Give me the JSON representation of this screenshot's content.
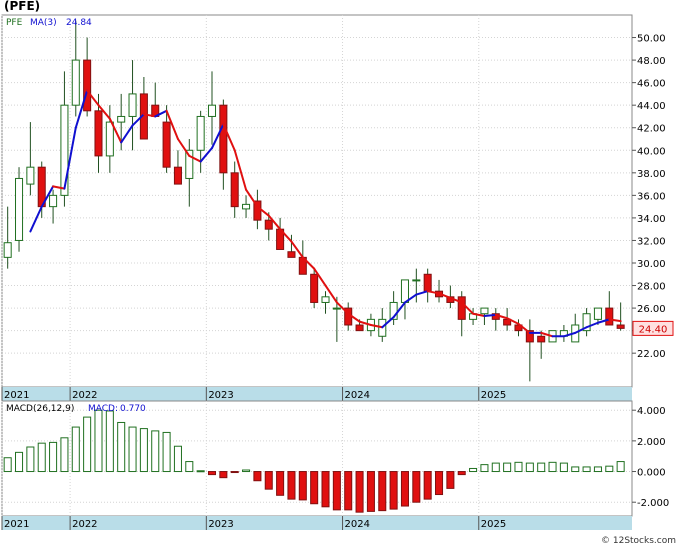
{
  "chart_data": [
    {
      "type": "candlestick",
      "title": "(PFE)",
      "legend": {
        "ticker": "PFE",
        "ma_label": "MA(3)",
        "ma_value": "24.84"
      },
      "last_price_label": "24.40",
      "ylim": [
        19,
        52
      ],
      "y_ticks": [
        22,
        24,
        26,
        28,
        30,
        32,
        34,
        36,
        38,
        40,
        42,
        44,
        46,
        48,
        50
      ],
      "y_tick_labels": [
        "22.00",
        "24.00",
        "26.00",
        "28.00",
        "30.00",
        "32.00",
        "34.00",
        "36.00",
        "38.00",
        "40.00",
        "42.00",
        "44.00",
        "46.00",
        "48.00",
        "50.00"
      ],
      "year_ticks": [
        {
          "label": "2021",
          "index": 0
        },
        {
          "label": "2022",
          "index": 6
        },
        {
          "label": "2023",
          "index": 18
        },
        {
          "label": "2024",
          "index": 30
        },
        {
          "label": "2025",
          "index": 42
        }
      ],
      "candles": [
        [
          30.5,
          35.0,
          29.5,
          31.8
        ],
        [
          32.0,
          38.5,
          31.0,
          37.5
        ],
        [
          37.0,
          42.5,
          36.0,
          38.5
        ],
        [
          38.5,
          39.0,
          34.0,
          35.0
        ],
        [
          35.0,
          36.5,
          33.5,
          36.0
        ],
        [
          36.0,
          47.0,
          35.0,
          44.0
        ],
        [
          44.0,
          51.5,
          43.0,
          48.0
        ],
        [
          48.0,
          50.0,
          43.0,
          43.5
        ],
        [
          43.5,
          45.0,
          38.0,
          39.5
        ],
        [
          39.5,
          44.0,
          38.0,
          42.5
        ],
        [
          42.5,
          45.0,
          40.0,
          43.0
        ],
        [
          43.0,
          48.0,
          40.0,
          45.0
        ],
        [
          45.0,
          46.5,
          41.5,
          41.0
        ],
        [
          44.0,
          46.0,
          43.0,
          43.0
        ],
        [
          42.5,
          44.0,
          38.0,
          38.5
        ],
        [
          38.5,
          40.0,
          37.0,
          37.0
        ],
        [
          37.5,
          41.0,
          35.0,
          40.0
        ],
        [
          40.0,
          43.5,
          38.0,
          43.0
        ],
        [
          43.0,
          47.0,
          40.5,
          44.0
        ],
        [
          44.0,
          44.5,
          36.5,
          38.0
        ],
        [
          38.0,
          39.0,
          34.0,
          35.0
        ],
        [
          34.8,
          36.0,
          34.0,
          35.2
        ],
        [
          35.5,
          36.5,
          33.0,
          33.8
        ],
        [
          33.8,
          34.5,
          32.0,
          33.0
        ],
        [
          33.0,
          34.0,
          31.5,
          31.2
        ],
        [
          31.0,
          32.5,
          31.0,
          30.5
        ],
        [
          30.5,
          32.0,
          29.0,
          29.0
        ],
        [
          29.0,
          29.5,
          26.0,
          26.5
        ],
        [
          26.5,
          27.5,
          25.5,
          27.0
        ],
        [
          26.0,
          27.0,
          23.0,
          26.0
        ],
        [
          26.0,
          26.5,
          24.0,
          24.5
        ],
        [
          24.5,
          25.0,
          24.0,
          24.0
        ],
        [
          24.0,
          25.5,
          23.5,
          25.0
        ],
        [
          23.5,
          26.0,
          23.0,
          25.0
        ],
        [
          25.0,
          27.5,
          24.5,
          26.5
        ],
        [
          26.5,
          28.5,
          25.0,
          28.5
        ],
        [
          28.5,
          29.5,
          26.5,
          28.5
        ],
        [
          29.0,
          29.5,
          26.5,
          27.5
        ],
        [
          27.5,
          28.5,
          26.5,
          27.0
        ],
        [
          27.0,
          28.0,
          26.0,
          26.5
        ],
        [
          27.0,
          27.5,
          23.5,
          25.0
        ],
        [
          25.0,
          26.0,
          24.5,
          25.5
        ],
        [
          25.5,
          26.0,
          24.5,
          26.0
        ],
        [
          25.5,
          26.0,
          24.0,
          25.0
        ],
        [
          25.0,
          26.0,
          24.0,
          24.5
        ],
        [
          24.5,
          25.0,
          23.5,
          24.0
        ],
        [
          24.0,
          25.0,
          19.5,
          23.0
        ],
        [
          23.5,
          24.0,
          21.5,
          23.0
        ],
        [
          23.0,
          24.0,
          23.0,
          24.0
        ],
        [
          23.5,
          24.5,
          23.0,
          24.0
        ],
        [
          23.0,
          25.5,
          23.0,
          24.5
        ],
        [
          24.0,
          26.0,
          23.5,
          25.5
        ],
        [
          25.0,
          26.0,
          24.5,
          26.0
        ],
        [
          26.0,
          27.5,
          24.5,
          24.5
        ],
        [
          24.5,
          26.5,
          24.0,
          24.2
        ]
      ],
      "ma": [
        null,
        null,
        32.8,
        35.0,
        36.8,
        36.6,
        42.0,
        45.3,
        44.0,
        42.8,
        40.7,
        42.2,
        43.2,
        43.0,
        43.5,
        41.0,
        39.5,
        39.0,
        40.2,
        42.3,
        40.0,
        36.5,
        35.0,
        34.2,
        33.0,
        31.9,
        30.5,
        29.5,
        28.0,
        26.5,
        25.5,
        24.8,
        24.5,
        24.3,
        25.2,
        26.5,
        27.2,
        27.5,
        27.3,
        26.9,
        26.5,
        25.5,
        25.3,
        25.4,
        25.1,
        24.6,
        23.8,
        23.8,
        23.5,
        23.5,
        23.8,
        24.3,
        24.7,
        25.0,
        24.84
      ],
      "ma_colors": {
        "up": "#1010d0",
        "down": "#e01010"
      },
      "candle_colors": {
        "up_fill": "#ffffff",
        "up_stroke": "#207020",
        "down_fill": "#e01010",
        "down_stroke": "#801010",
        "wick": "#205020"
      }
    },
    {
      "type": "bar",
      "title": "MACD(26,12,9)",
      "value_label": "MACD:",
      "value": "0.770",
      "ylim": [
        -2900,
        4600
      ],
      "y_ticks": [
        -2000,
        0,
        2000,
        4000
      ],
      "y_tick_labels": [
        "-2.000",
        "0.000",
        "2.000",
        "4.000"
      ],
      "year_ticks": [
        {
          "label": "2021",
          "index": 0
        },
        {
          "label": "2022",
          "index": 6
        },
        {
          "label": "2023",
          "index": 18
        },
        {
          "label": "2024",
          "index": 30
        },
        {
          "label": "2025",
          "index": 42
        }
      ],
      "values": [
        900,
        1250,
        1600,
        1850,
        1900,
        2200,
        2900,
        3550,
        4000,
        3950,
        3200,
        2900,
        2800,
        2650,
        2550,
        1650,
        650,
        50,
        -200,
        -400,
        -50,
        100,
        -600,
        -1150,
        -1550,
        -1800,
        -1850,
        -2100,
        -2300,
        -2500,
        -2500,
        -2650,
        -2600,
        -2550,
        -2450,
        -2250,
        -2000,
        -1800,
        -1500,
        -1100,
        -200,
        200,
        450,
        550,
        550,
        600,
        550,
        550,
        600,
        550,
        300,
        300,
        300,
        350,
        650
      ],
      "colors": {
        "pos_fill": "#ffffff",
        "pos_stroke": "#207020",
        "neg_fill": "#e01010",
        "neg_stroke": "#801010"
      }
    }
  ],
  "watermark": "© 12Stocks.com"
}
